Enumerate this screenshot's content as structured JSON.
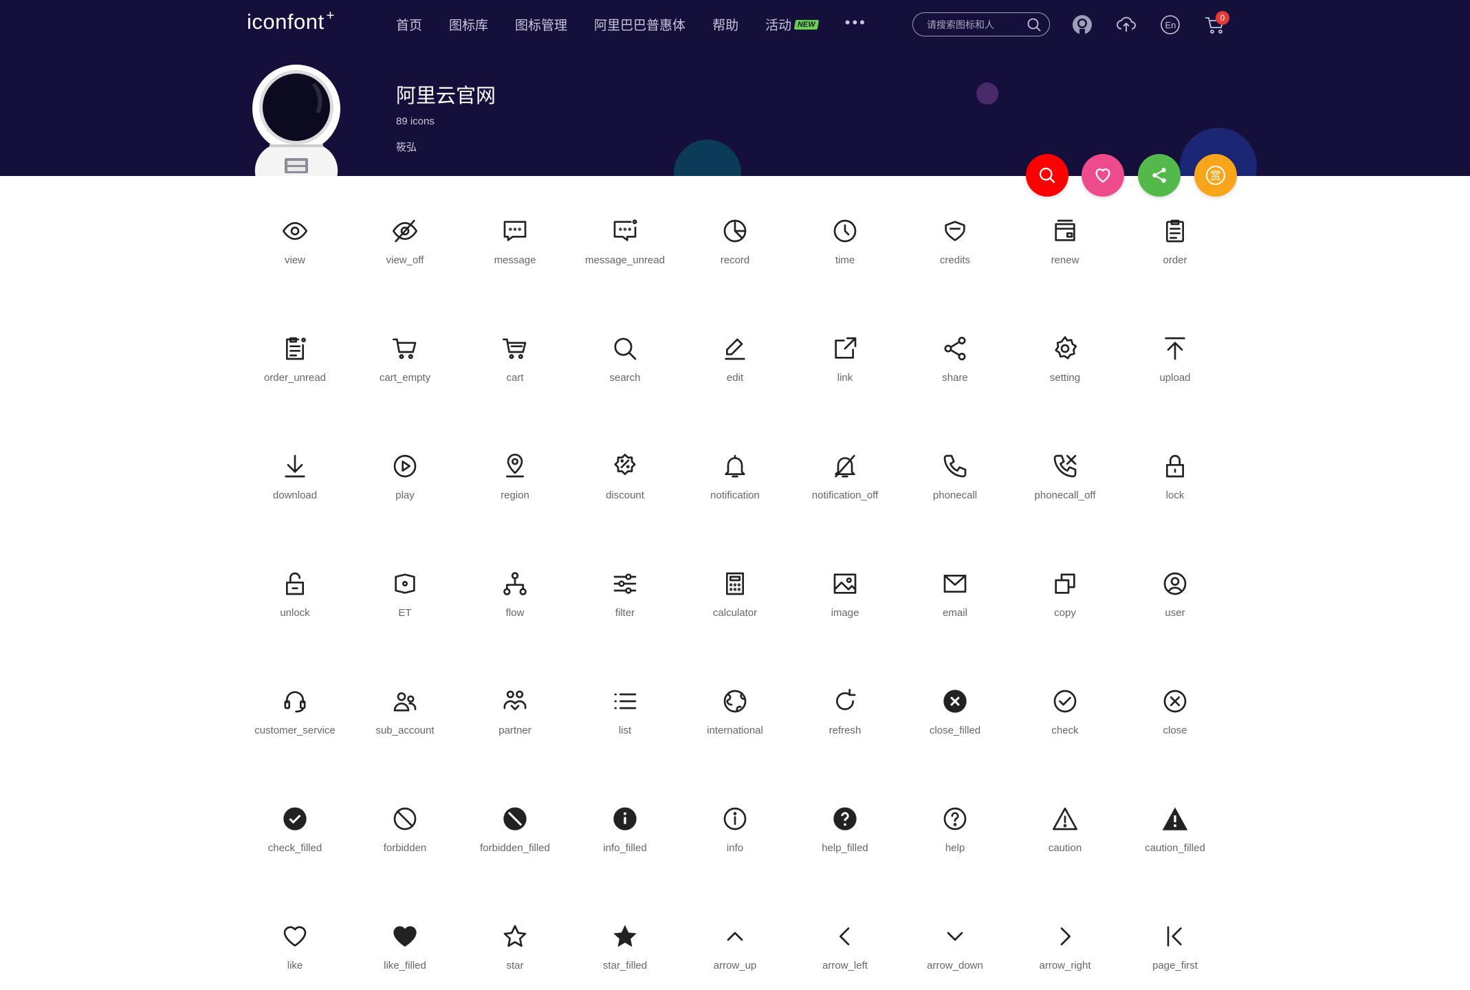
{
  "brand": {
    "logo": "iconfont",
    "logo_mark": "+"
  },
  "nav": {
    "items": [
      "首页",
      "图标库",
      "图标管理",
      "阿里巴巴普惠体",
      "帮助",
      "活动"
    ],
    "activity_badge": "NEW",
    "more": "•••"
  },
  "search": {
    "placeholder": "请搜索图标和人"
  },
  "header_icons": [
    "github-icon",
    "upload-cloud-icon",
    "language-en-icon",
    "cart-icon"
  ],
  "cart": {
    "count": "0"
  },
  "project": {
    "name": "阿里云官网",
    "count_text": "89 icons",
    "owner": "筱弘"
  },
  "actions": [
    {
      "name": "search",
      "color": "#ff0000"
    },
    {
      "name": "favorite",
      "color": "#ee4b8d"
    },
    {
      "name": "share",
      "color": "#52b94a"
    },
    {
      "name": "reward",
      "color": "#f8a51c",
      "text": "赏"
    }
  ],
  "icons": [
    "view",
    "view_off",
    "message",
    "message_unread",
    "record",
    "time",
    "credits",
    "renew",
    "order",
    "order_unread",
    "cart_empty",
    "cart",
    "search",
    "edit",
    "link",
    "share",
    "setting",
    "upload",
    "download",
    "play",
    "region",
    "discount",
    "notification",
    "notification_off",
    "phonecall",
    "phonecall_off",
    "lock",
    "unlock",
    "ET",
    "flow",
    "filter",
    "calculator",
    "image",
    "email",
    "copy",
    "user",
    "customer_service",
    "sub_account",
    "partner",
    "list",
    "international",
    "refresh",
    "close_filled",
    "check",
    "close",
    "check_filled",
    "forbidden",
    "forbidden_filled",
    "info_filled",
    "info",
    "help_filled",
    "help",
    "caution",
    "caution_filled",
    "like",
    "like_filled",
    "star",
    "star_filled",
    "arrow_up",
    "arrow_left",
    "arrow_down",
    "arrow_right",
    "page_first"
  ],
  "colors": {
    "header_bg": "#150f3c",
    "icon_stroke": "#222222",
    "label": "#666666"
  }
}
